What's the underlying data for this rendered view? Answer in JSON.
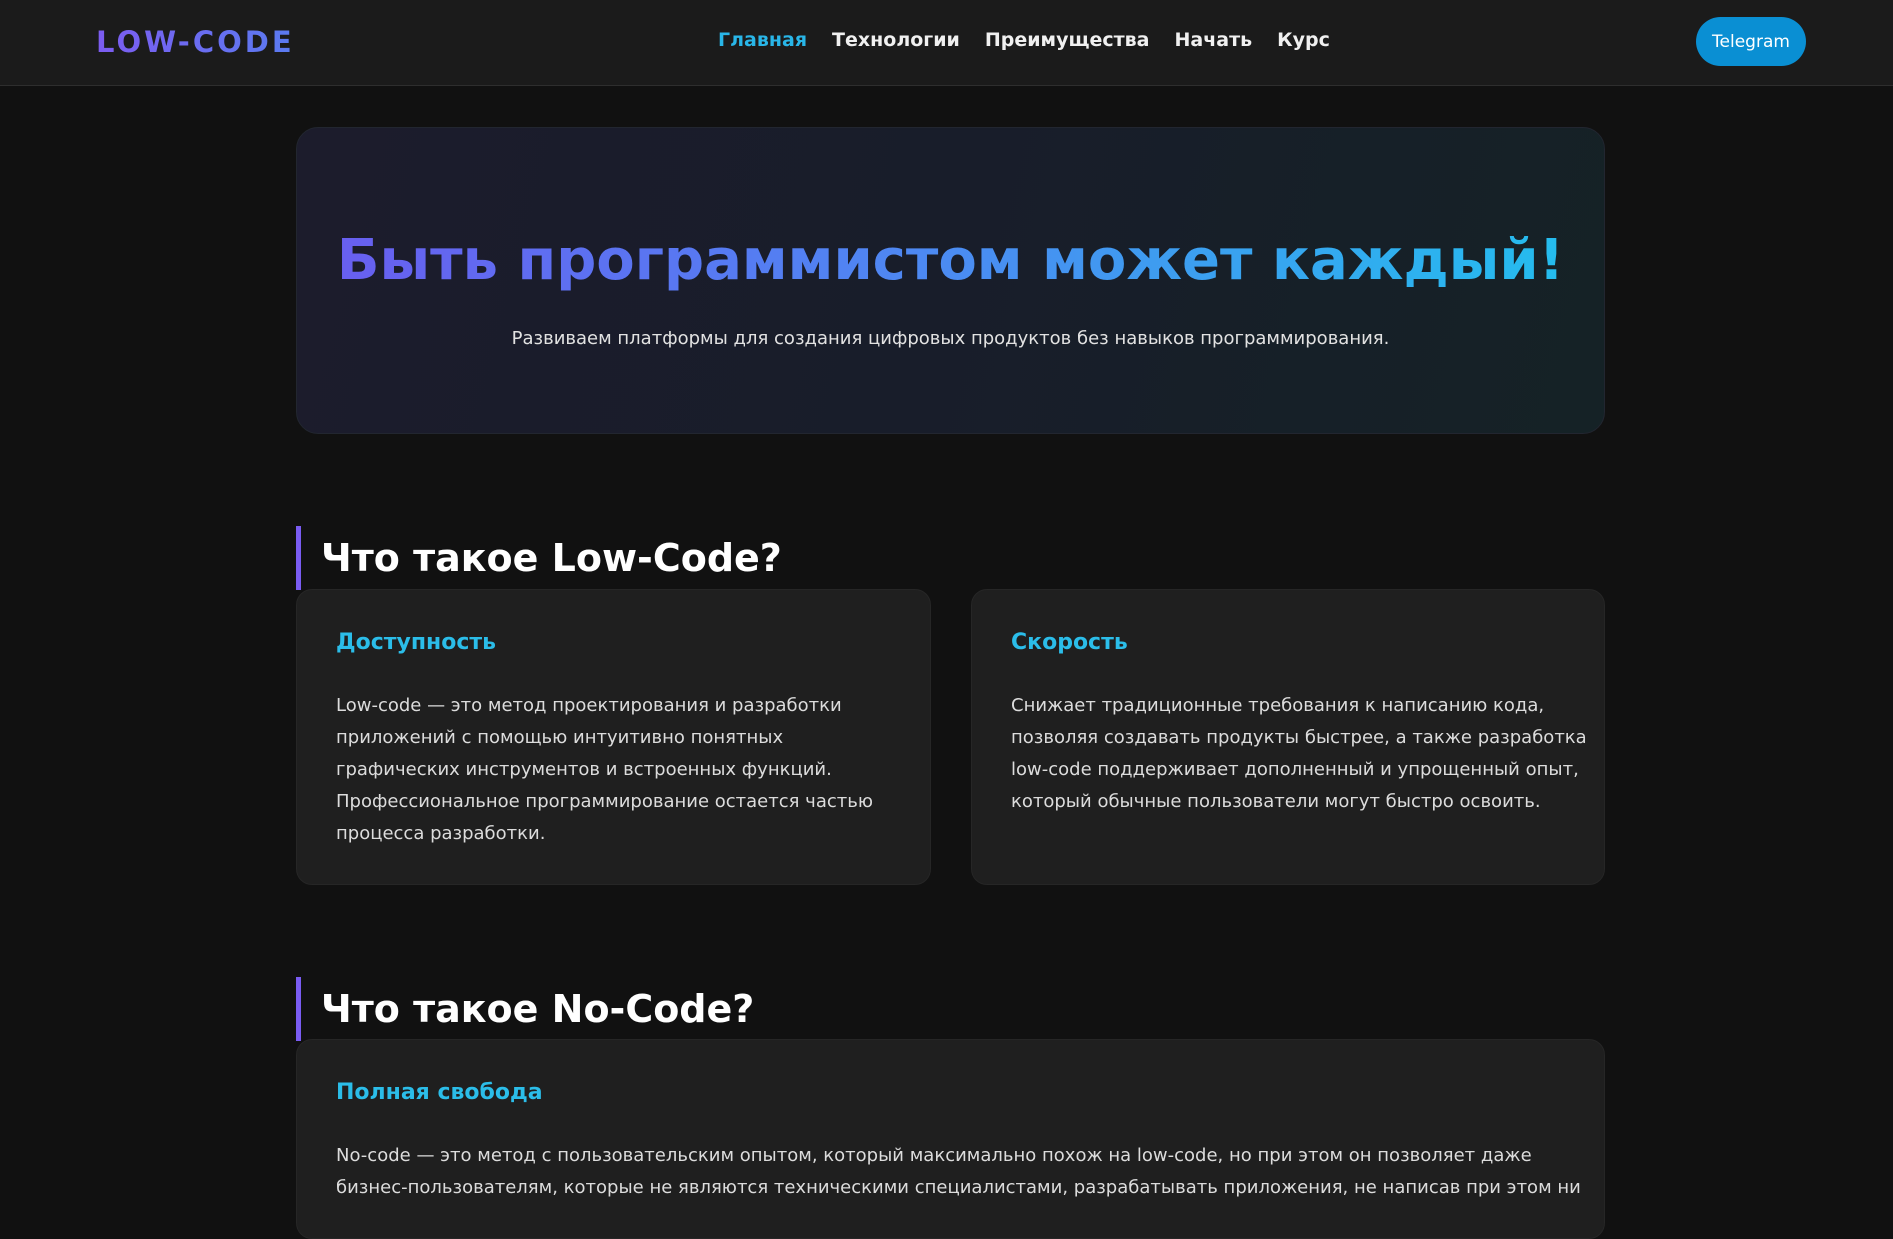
{
  "header": {
    "logo": "LOW-CODE",
    "nav": [
      "Главная",
      "Технологии",
      "Преимущества",
      "Начать",
      "Курс"
    ],
    "active_nav": "Главная",
    "telegram_label": "Telegram"
  },
  "hero": {
    "title": "Быть программистом может каждый!",
    "subtitle": "Развиваем платформы для создания цифровых продуктов без навыков программирования."
  },
  "sections": [
    {
      "title": "Что такое Low-Code?",
      "cards": [
        {
          "title": "Доступность",
          "lines": [
            "Low-code — это метод проектирования и разработки",
            "приложений с помощью интуитивно понятных",
            "графических инструментов и встроенных функций.",
            "Профессиональное программирование остается частью",
            "процесса разработки."
          ]
        },
        {
          "title": "Скорость",
          "lines": [
            "Снижает традиционные требования к написанию кода,",
            "позволяя создавать продукты быстрее, а также разработка",
            "low-code поддерживает дополненный и упрощенный опыт,",
            "который обычные пользователи могут быстро освоить."
          ]
        }
      ]
    },
    {
      "title": "Что такое No-Code?",
      "cards": [
        {
          "title": "Полная свобода",
          "lines": [
            "No-code — это метод с пользовательским опытом, который максимально похож на low-code, но при этом он позволяет даже",
            "бизнес-пользователям, которые не являются техническими специалистами, разрабатывать приложения, не написав при этом ни"
          ]
        }
      ]
    }
  ],
  "colors": {
    "accent_purple": "#7a5cf2",
    "accent_cyan": "#2bbde9",
    "telegram_blue": "#0a8fd3",
    "background": "#111111"
  }
}
